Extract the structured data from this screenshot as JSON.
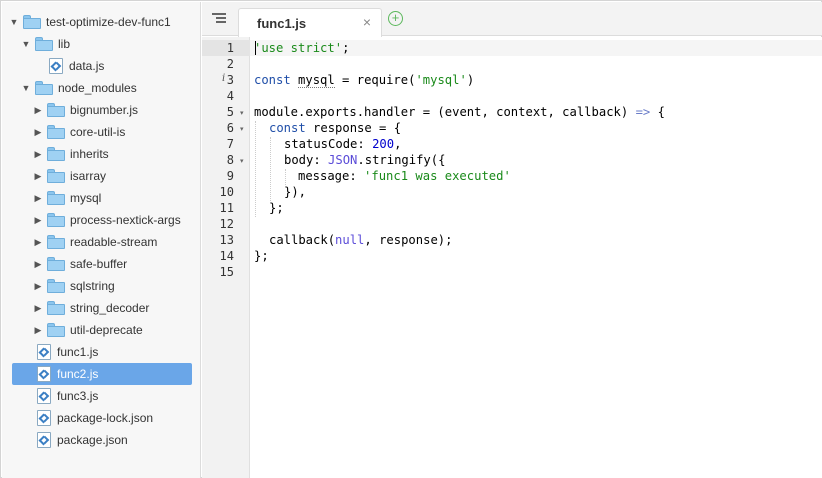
{
  "sidebar": {
    "tree": [
      {
        "label": "test-optimize-dev-func1",
        "type": "folder",
        "expanded": true,
        "depth": 0
      },
      {
        "label": "lib",
        "type": "folder",
        "expanded": true,
        "depth": 1
      },
      {
        "label": "data.js",
        "type": "file",
        "depth": 2
      },
      {
        "label": "node_modules",
        "type": "folder",
        "expanded": true,
        "depth": 1
      },
      {
        "label": "bignumber.js",
        "type": "folder",
        "expanded": false,
        "depth": 2
      },
      {
        "label": "core-util-is",
        "type": "folder",
        "expanded": false,
        "depth": 2
      },
      {
        "label": "inherits",
        "type": "folder",
        "expanded": false,
        "depth": 2
      },
      {
        "label": "isarray",
        "type": "folder",
        "expanded": false,
        "depth": 2
      },
      {
        "label": "mysql",
        "type": "folder",
        "expanded": false,
        "depth": 2
      },
      {
        "label": "process-nextick-args",
        "type": "folder",
        "expanded": false,
        "depth": 2
      },
      {
        "label": "readable-stream",
        "type": "folder",
        "expanded": false,
        "depth": 2
      },
      {
        "label": "safe-buffer",
        "type": "folder",
        "expanded": false,
        "depth": 2
      },
      {
        "label": "sqlstring",
        "type": "folder",
        "expanded": false,
        "depth": 2
      },
      {
        "label": "string_decoder",
        "type": "folder",
        "expanded": false,
        "depth": 2
      },
      {
        "label": "util-deprecate",
        "type": "folder",
        "expanded": false,
        "depth": 2
      },
      {
        "label": "func1.js",
        "type": "file",
        "depth": 1
      },
      {
        "label": "func2.js",
        "type": "file",
        "depth": 1,
        "selected": true
      },
      {
        "label": "func3.js",
        "type": "file",
        "depth": 1
      },
      {
        "label": "package-lock.json",
        "type": "file",
        "depth": 1
      },
      {
        "label": "package.json",
        "type": "file",
        "depth": 1
      }
    ],
    "selected_color": "#6aa6e8"
  },
  "tabbar": {
    "tabs": [
      {
        "title": "func1.js",
        "close": "×"
      }
    ],
    "add_tab": "+",
    "menu_icon": "list-icon",
    "add_icon": "plus-circle-icon"
  },
  "editor": {
    "line_numbers": [
      "1",
      "2",
      "3",
      "4",
      "5",
      "6",
      "7",
      "8",
      "9",
      "10",
      "11",
      "12",
      "13",
      "14",
      "15"
    ],
    "code": {
      "l1_str": "'use strict'",
      "l1_end": ";",
      "l3_kw": "const",
      "l3_var": "mysql",
      "l3_mid": " = require(",
      "l3_str": "'mysql'",
      "l3_end": ")",
      "l5_a": "module.exports.handler = (event, context, callback) ",
      "l5_arrow": "=>",
      "l5_b": " {",
      "l6_kw": "const",
      "l6_rest": " response = {",
      "l7_a": "statusCode: ",
      "l7_num": "200",
      "l7_b": ",",
      "l8_a": "body: ",
      "l8_const": "JSON",
      "l8_b": ".stringify({",
      "l9_a": "message: ",
      "l9_str": "'func1 was executed'",
      "l10": "}),",
      "l11": "};",
      "l13_a": "callback(",
      "l13_null": "null",
      "l13_b": ", response);",
      "l14": "};"
    },
    "info_marker": "i",
    "fold_marker": "▾"
  }
}
